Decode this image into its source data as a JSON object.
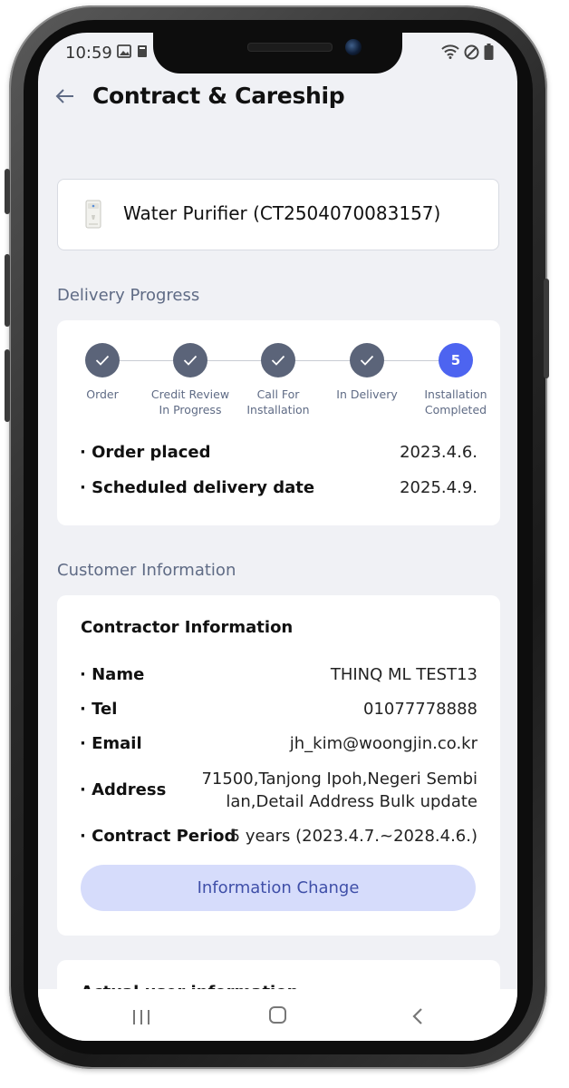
{
  "status_bar": {
    "time": "10:59",
    "left_icons": [
      "image-icon",
      "notification-icon"
    ],
    "right_icons": [
      "wifi-icon",
      "do-not-disturb-icon",
      "battery-icon"
    ]
  },
  "header": {
    "title": "Contract & Careship",
    "back_icon": "back-arrow-icon"
  },
  "product": {
    "icon": "water-purifier-icon",
    "name": "Water Purifier (CT2504070083157)"
  },
  "delivery_progress": {
    "section_title": "Delivery Progress",
    "steps": [
      {
        "label": "Order",
        "status": "done"
      },
      {
        "label": "Credit Review In Progress",
        "status": "done"
      },
      {
        "label": "Call For Installation",
        "status": "done"
      },
      {
        "label": "In Delivery",
        "status": "done"
      },
      {
        "label": "Installation Completed",
        "status": "current",
        "number": "5"
      }
    ],
    "details": [
      {
        "label": "· Order placed",
        "value": "2023.4.6."
      },
      {
        "label": "· Scheduled delivery date",
        "value": "2025.4.9."
      }
    ],
    "colors": {
      "done": "#5b6479",
      "current": "#4d64f0"
    }
  },
  "customer_information": {
    "section_title": "Customer Information",
    "contractor": {
      "title": "Contractor Information",
      "rows": [
        {
          "label": "· Name",
          "value": "THINQ ML TEST13"
        },
        {
          "label": "· Tel",
          "value": "01077778888"
        },
        {
          "label": "· Email",
          "value": "jh_kim@woongjin.co.kr"
        },
        {
          "label": "· Address",
          "value_line1": "71500,Tanjong Ipoh,Negeri Sembi",
          "value_line2": "lan,Detail Address Bulk update"
        },
        {
          "label": "· Contract Period",
          "value": "5 years (2023.4.7.~2028.4.6.)"
        }
      ],
      "button_label": "Information Change"
    },
    "actual_user": {
      "title": "Actual user information"
    }
  },
  "nav_bar": {
    "icons": [
      "recent-apps-icon",
      "home-icon",
      "back-icon"
    ]
  }
}
